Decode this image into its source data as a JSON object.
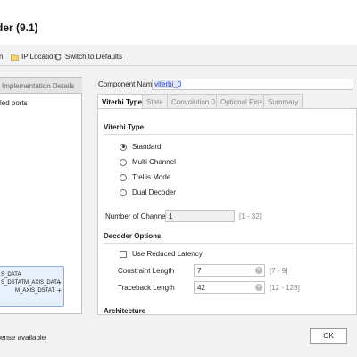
{
  "window": {
    "title": "der (9.1)"
  },
  "toolbar": {
    "items": [
      {
        "label": "n",
        "icon": "doc-icon"
      },
      {
        "label": "IP Location",
        "icon": "folder-icon"
      },
      {
        "label": "Switch to Defaults",
        "icon": "refresh-icon"
      }
    ]
  },
  "left_panel": {
    "tab_label": "Implementation Details",
    "line": "led ports",
    "ip_block": {
      "ports": [
        "S_DATA",
        "S_DSTAT",
        "M_AXIS_DATA",
        "M_AXIS_DSTAT"
      ]
    }
  },
  "component": {
    "label": "Component Name",
    "value": "viterbi_0"
  },
  "tabs": [
    {
      "label": "Viterbi Type",
      "active": true
    },
    {
      "label": "State",
      "active": false
    },
    {
      "label": "Convolution 0",
      "active": false
    },
    {
      "label": "Optional Pins",
      "active": false
    },
    {
      "label": "Summary",
      "active": false
    }
  ],
  "viterbi_type": {
    "title": "Viterbi Type",
    "options": [
      {
        "label": "Standard",
        "selected": true
      },
      {
        "label": "Multi Channel",
        "selected": false
      },
      {
        "label": "Trellis Mode",
        "selected": false
      },
      {
        "label": "Dual Decoder",
        "selected": false
      }
    ]
  },
  "channels": {
    "label": "Number of Channels",
    "value": "1",
    "range": "[1 - 32]"
  },
  "decoder_options": {
    "title": "Decoder Options",
    "reduced_latency": {
      "label": "Use Reduced Latency",
      "checked": false
    },
    "constraint_length": {
      "label": "Constraint Length",
      "value": "7",
      "range": "[7 - 9]"
    },
    "traceback_length": {
      "label": "Traceback Length",
      "value": "42",
      "range": "[12 - 128]"
    }
  },
  "architecture": {
    "title": "Architecture"
  },
  "footer": {
    "note": "ense available",
    "ok_label": "OK"
  },
  "colors": {
    "accent": "#2a47b8",
    "ip_block_fill": "#e8f1fb",
    "ip_block_border": "#8aaed6"
  }
}
